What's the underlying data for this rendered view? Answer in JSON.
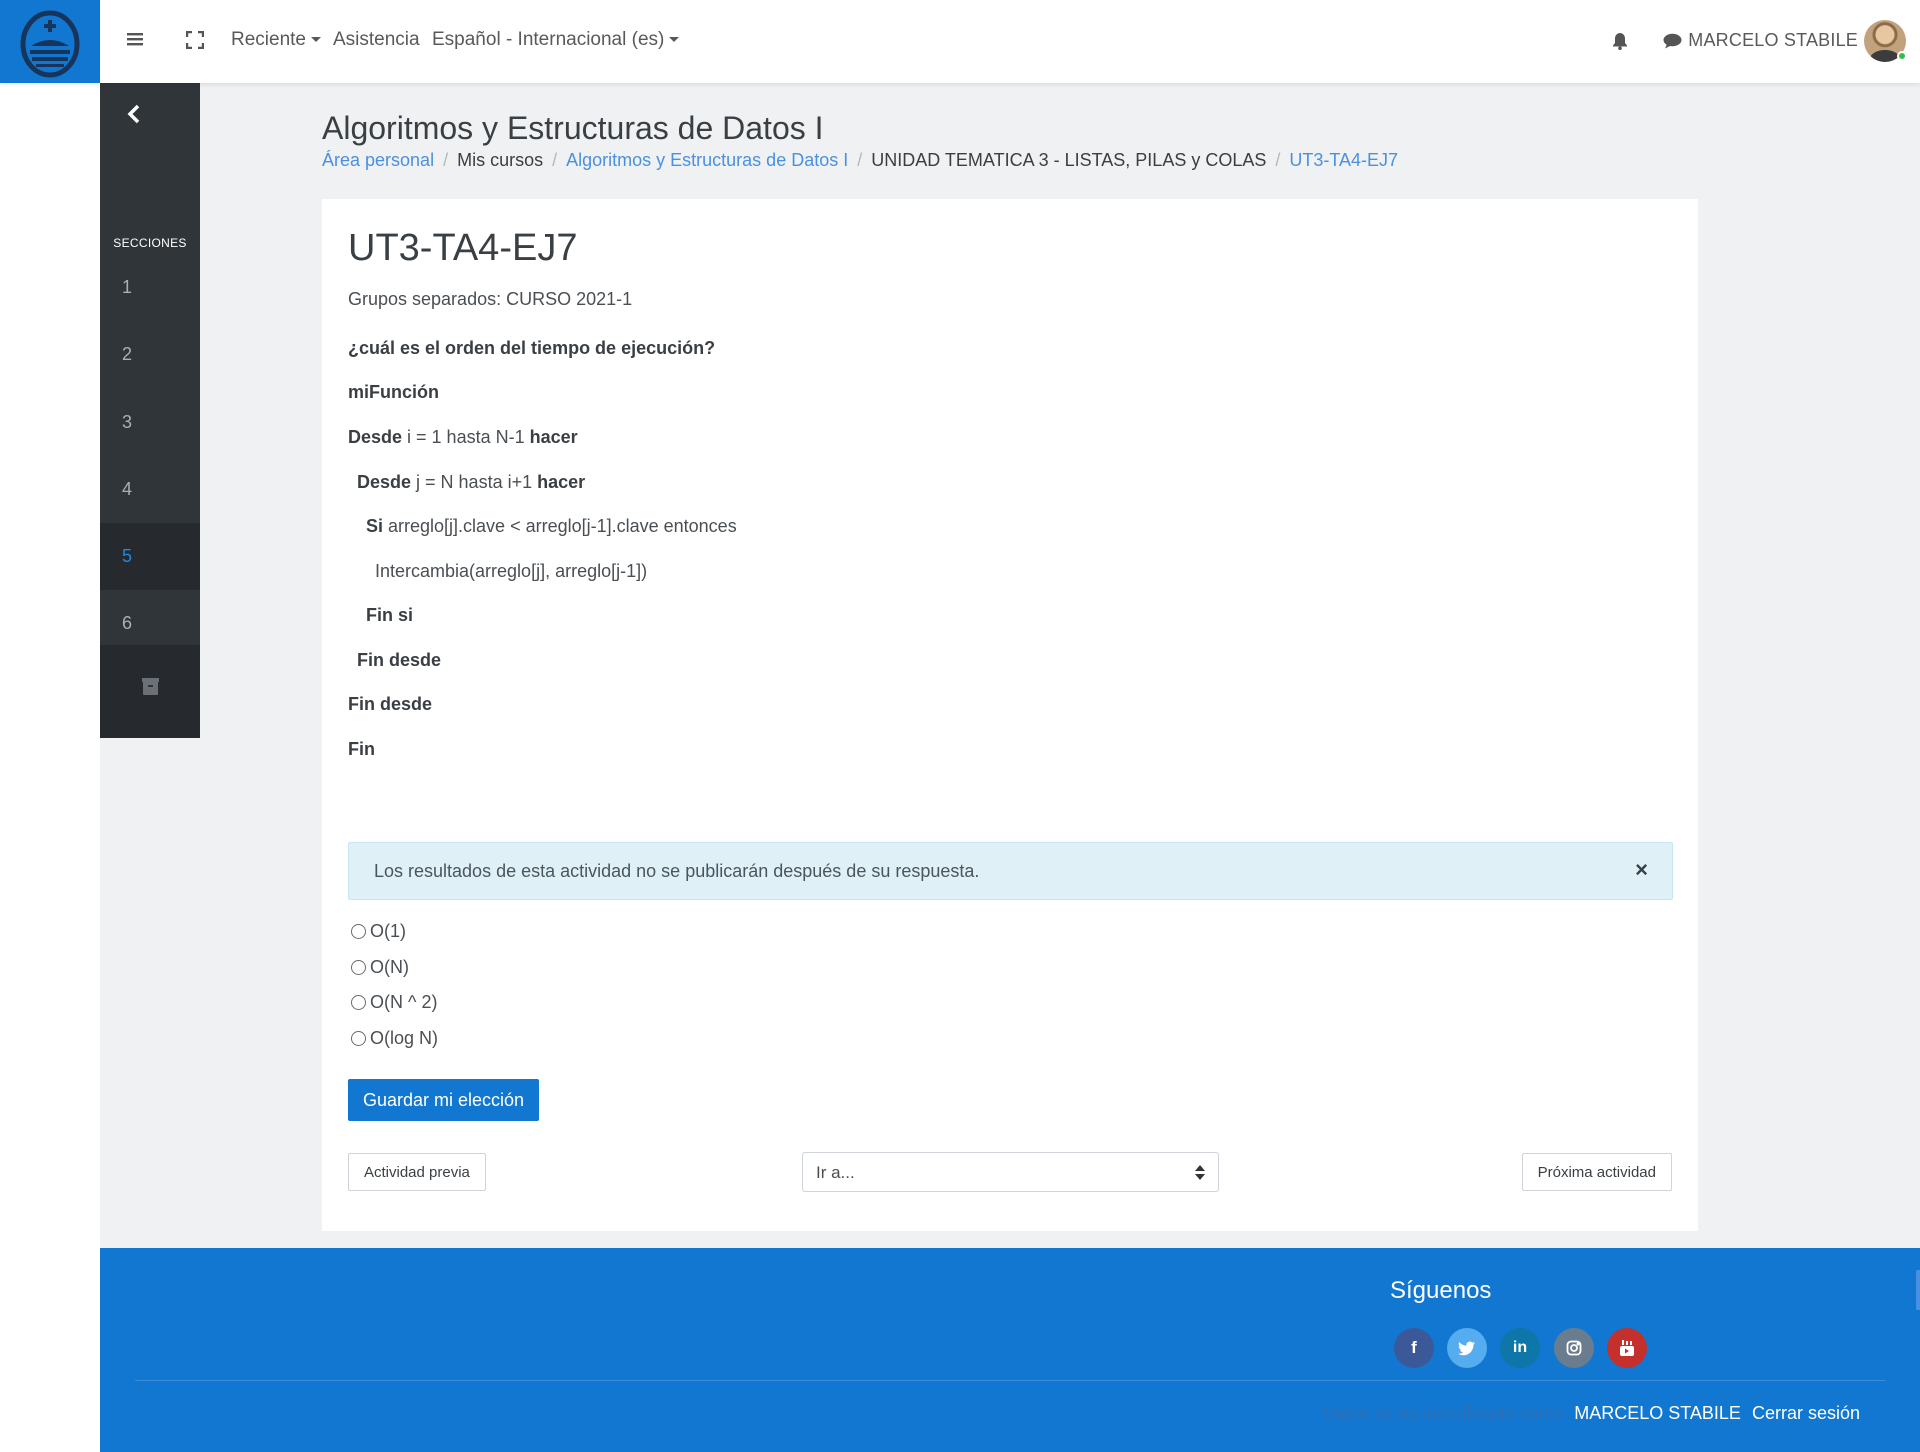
{
  "navbar": {
    "menu_items": [
      {
        "label": "Reciente",
        "has_caret": true
      },
      {
        "label": "Asistencia",
        "has_caret": false
      },
      {
        "label": "Español - Internacional (es)",
        "has_caret": true
      }
    ],
    "user_name": "MARCELO STABILE"
  },
  "drawer": {
    "title": "SECCIONES",
    "sections": [
      "1",
      "2",
      "3",
      "4",
      "5",
      "6"
    ],
    "active_section": "5"
  },
  "page": {
    "course_title": "Algoritmos y Estructuras de Datos I",
    "breadcrumb": [
      {
        "label": "Área personal",
        "link": true
      },
      {
        "label": "Mis cursos",
        "link": false
      },
      {
        "label": "Algoritmos y Estructuras de Datos I",
        "link": true
      },
      {
        "label": "UNIDAD TEMATICA 3 - LISTAS, PILAS y COLAS",
        "link": false
      },
      {
        "label": "UT3-TA4-EJ7",
        "link": true
      }
    ]
  },
  "activity": {
    "title": "UT3-TA4-EJ7",
    "groups": "Grupos separados: CURSO 2021-1",
    "question": "¿cuál es el orden del tiempo de ejecución?",
    "code": [
      {
        "bold": "miFunción",
        "rest": "",
        "bold2": ""
      },
      {
        "bold": "Desde",
        "rest": " i = 1 hasta N-1 ",
        "bold2": "hacer"
      },
      {
        "bold": " Desde",
        "rest": " j = N hasta i+1 ",
        "bold2": "hacer"
      },
      {
        "bold": "  Si",
        "rest": " arreglo[j].clave < arreglo[j-1].clave entonces",
        "bold2": ""
      },
      {
        "bold": "",
        "rest": "   Intercambia(arreglo[j], arreglo[j-1])",
        "bold2": ""
      },
      {
        "bold": "  Fin si",
        "rest": "",
        "bold2": ""
      },
      {
        "bold": " Fin desde",
        "rest": "",
        "bold2": ""
      },
      {
        "bold": "Fin desde",
        "rest": "",
        "bold2": ""
      },
      {
        "bold": "Fin",
        "rest": "",
        "bold2": ""
      }
    ],
    "alert": "Los resultados de esta actividad no se publicarán después de su respuesta.",
    "alert_close": "×",
    "options": [
      "O(1)",
      "O(N)",
      "O(N ^ 2)",
      "O(log N)"
    ],
    "save_label": "Guardar mi elección",
    "prev_label": "Actividad previa",
    "jump_placeholder": "Ir a...",
    "next_label": "Próxima actividad"
  },
  "footer": {
    "follow_label": "Síguenos",
    "social_icons": [
      "facebook-icon",
      "twitter-icon",
      "linkedin-icon",
      "instagram-icon",
      "youtube-icon"
    ],
    "social_colors": [
      "#3b5998",
      "#55acee",
      "#0e76a8",
      "#6a7d8f",
      "#c4302b"
    ],
    "logged_prefix": "Usted se ha identificado como",
    "logged_user": "MARCELO STABILE",
    "logout_label": "Cerrar sesión"
  },
  "colors": {
    "brand_blue": "#1177d1",
    "drawer_bg": "#30353a",
    "link": "#4a90e2",
    "active_section": "#1e88e5",
    "alert_bg": "#dff0f7"
  }
}
